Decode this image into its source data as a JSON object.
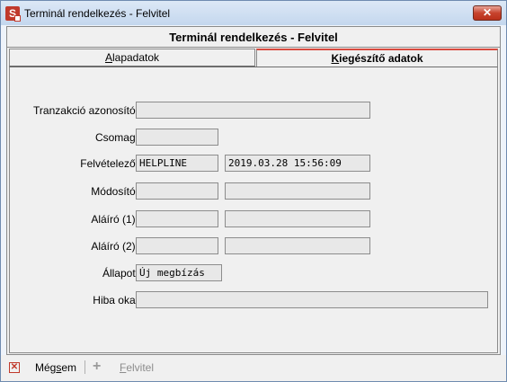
{
  "window": {
    "title": "Terminál rendelkezés - Felvitel",
    "close_glyph": "✕"
  },
  "header": {
    "title": "Terminál rendelkezés - Felvitel"
  },
  "tabs": [
    {
      "label": "Alapadatok",
      "accel": "A",
      "rest": "lapadatok",
      "active": false
    },
    {
      "label": "Kiegészítő adatok",
      "accel": "K",
      "rest": "iegészítő adatok",
      "active": true
    }
  ],
  "form": {
    "transaction_id": {
      "label": "Tranzakció azonosító:",
      "value": ""
    },
    "package": {
      "label": "Csomag:",
      "value": ""
    },
    "created_by": {
      "label": "Felvételező:",
      "user": "HELPLINE",
      "datetime": "2019.03.28 15:56:09"
    },
    "modified_by": {
      "label": "Módosító:",
      "user": "",
      "datetime": ""
    },
    "signer1": {
      "label": "Aláíró (1):",
      "user": "",
      "datetime": ""
    },
    "signer2": {
      "label": "Aláíró (2):",
      "user": "",
      "datetime": ""
    },
    "status": {
      "label": "Állapot:",
      "value": "Új megbízás"
    },
    "error_reason": {
      "label": "Hiba oka:",
      "value": ""
    }
  },
  "toolbar": {
    "cancel_label_pre": "Még",
    "cancel_label_accel": "s",
    "cancel_label_post": "em",
    "create_label_accel": "F",
    "create_label_rest": "elvitel",
    "create_enabled": false
  },
  "colors": {
    "accent": "#d84a3f",
    "close": "#c7432d",
    "window_border": "#6f8bb0"
  },
  "icons": {
    "app": "app-logo-icon",
    "close": "close-icon",
    "cancel": "cancel-x-icon",
    "create": "plus-icon"
  }
}
